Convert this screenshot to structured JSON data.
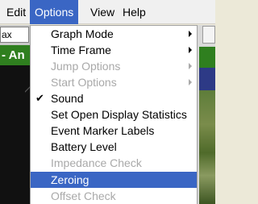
{
  "menubar": {
    "items": [
      {
        "label": "Edit",
        "active": false
      },
      {
        "label": "Options",
        "active": true
      },
      {
        "label": "View",
        "active": false
      },
      {
        "label": "Help",
        "active": false
      }
    ]
  },
  "background": {
    "field_text": "ax",
    "banner_text": "- An"
  },
  "options_menu": {
    "items": [
      {
        "label": "Graph Mode",
        "enabled": true,
        "submenu": true,
        "checked": false
      },
      {
        "label": "Time Frame",
        "enabled": true,
        "submenu": true,
        "checked": false
      },
      {
        "label": "Jump Options",
        "enabled": false,
        "submenu": true,
        "checked": false
      },
      {
        "label": "Start Options",
        "enabled": false,
        "submenu": true,
        "checked": false
      },
      {
        "label": "Sound",
        "enabled": true,
        "submenu": false,
        "checked": true
      },
      {
        "label": "Set Open Display Statistics",
        "enabled": true,
        "submenu": false,
        "checked": false
      },
      {
        "label": "Event Marker Labels",
        "enabled": true,
        "submenu": false,
        "checked": false
      },
      {
        "label": "Battery Level",
        "enabled": true,
        "submenu": false,
        "checked": false
      },
      {
        "label": "Impedance Check",
        "enabled": false,
        "submenu": false,
        "checked": false
      },
      {
        "label": "Zeroing",
        "enabled": true,
        "submenu": false,
        "checked": false,
        "highlighted": true
      },
      {
        "label": "Offset Check",
        "enabled": false,
        "submenu": false,
        "checked": false
      }
    ],
    "check_glyph": "✔"
  },
  "colors": {
    "highlight": "#3a66c4",
    "disabled_text": "#a9a9a9",
    "banner_green": "#2f7f1f"
  }
}
